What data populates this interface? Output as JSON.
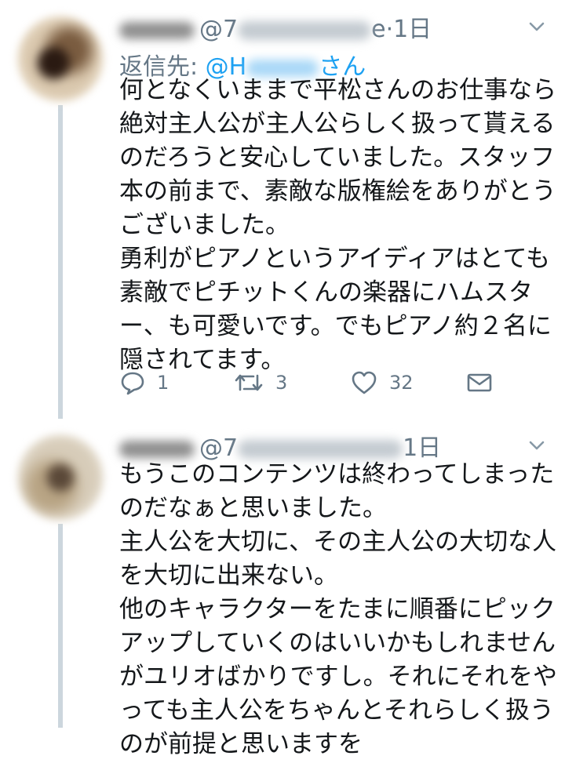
{
  "tweets": [
    {
      "handle_prefix": "@7",
      "handle_suffix": "e",
      "time": "·1日",
      "reply_prefix": "返信先: ",
      "reply_handle_prefix": "@H",
      "reply_handle_suffix": "さん",
      "text": "何となくいままで平松さんのお仕事なら\n絶対主人公が主人公らしく扱って貰える\nのだろうと安心していました。スタッフ\n本の前まで、素敵な版権絵をありがとう\nございました。\n勇利がピアノというアイディアはとても\n素敵でピチットくんの楽器にハムスタ\nー、も可愛いです。でもピアノ約２名に\n隠されてます。",
      "actions": {
        "reply_count": "1",
        "retweet_count": "3",
        "like_count": "32"
      },
      "icons": {
        "more": "chevron-down-icon",
        "reply": "reply-icon",
        "retweet": "retweet-icon",
        "like": "heart-icon",
        "dm": "envelope-icon"
      }
    },
    {
      "handle_prefix": "@7",
      "time": "1日",
      "text": "もうこのコンテンツは終わってしまった\nのだなぁと思いました。\n主人公を大切に、その主人公の大切な人\nを大切に出来ない。\n他のキャラクターをたまに順番にピック\nアップしていくのはいいかもしれません\nがユリオばかりですし。それにそれをや\nっても主人公をちゃんとそれらしく扱う\nのが前提と思いますを",
      "icons": {
        "more": "chevron-down-icon"
      }
    }
  ],
  "colors": {
    "text": "#14171a",
    "muted": "#657786",
    "link": "#1da1f2",
    "thread_line": "#ccd6dd"
  }
}
